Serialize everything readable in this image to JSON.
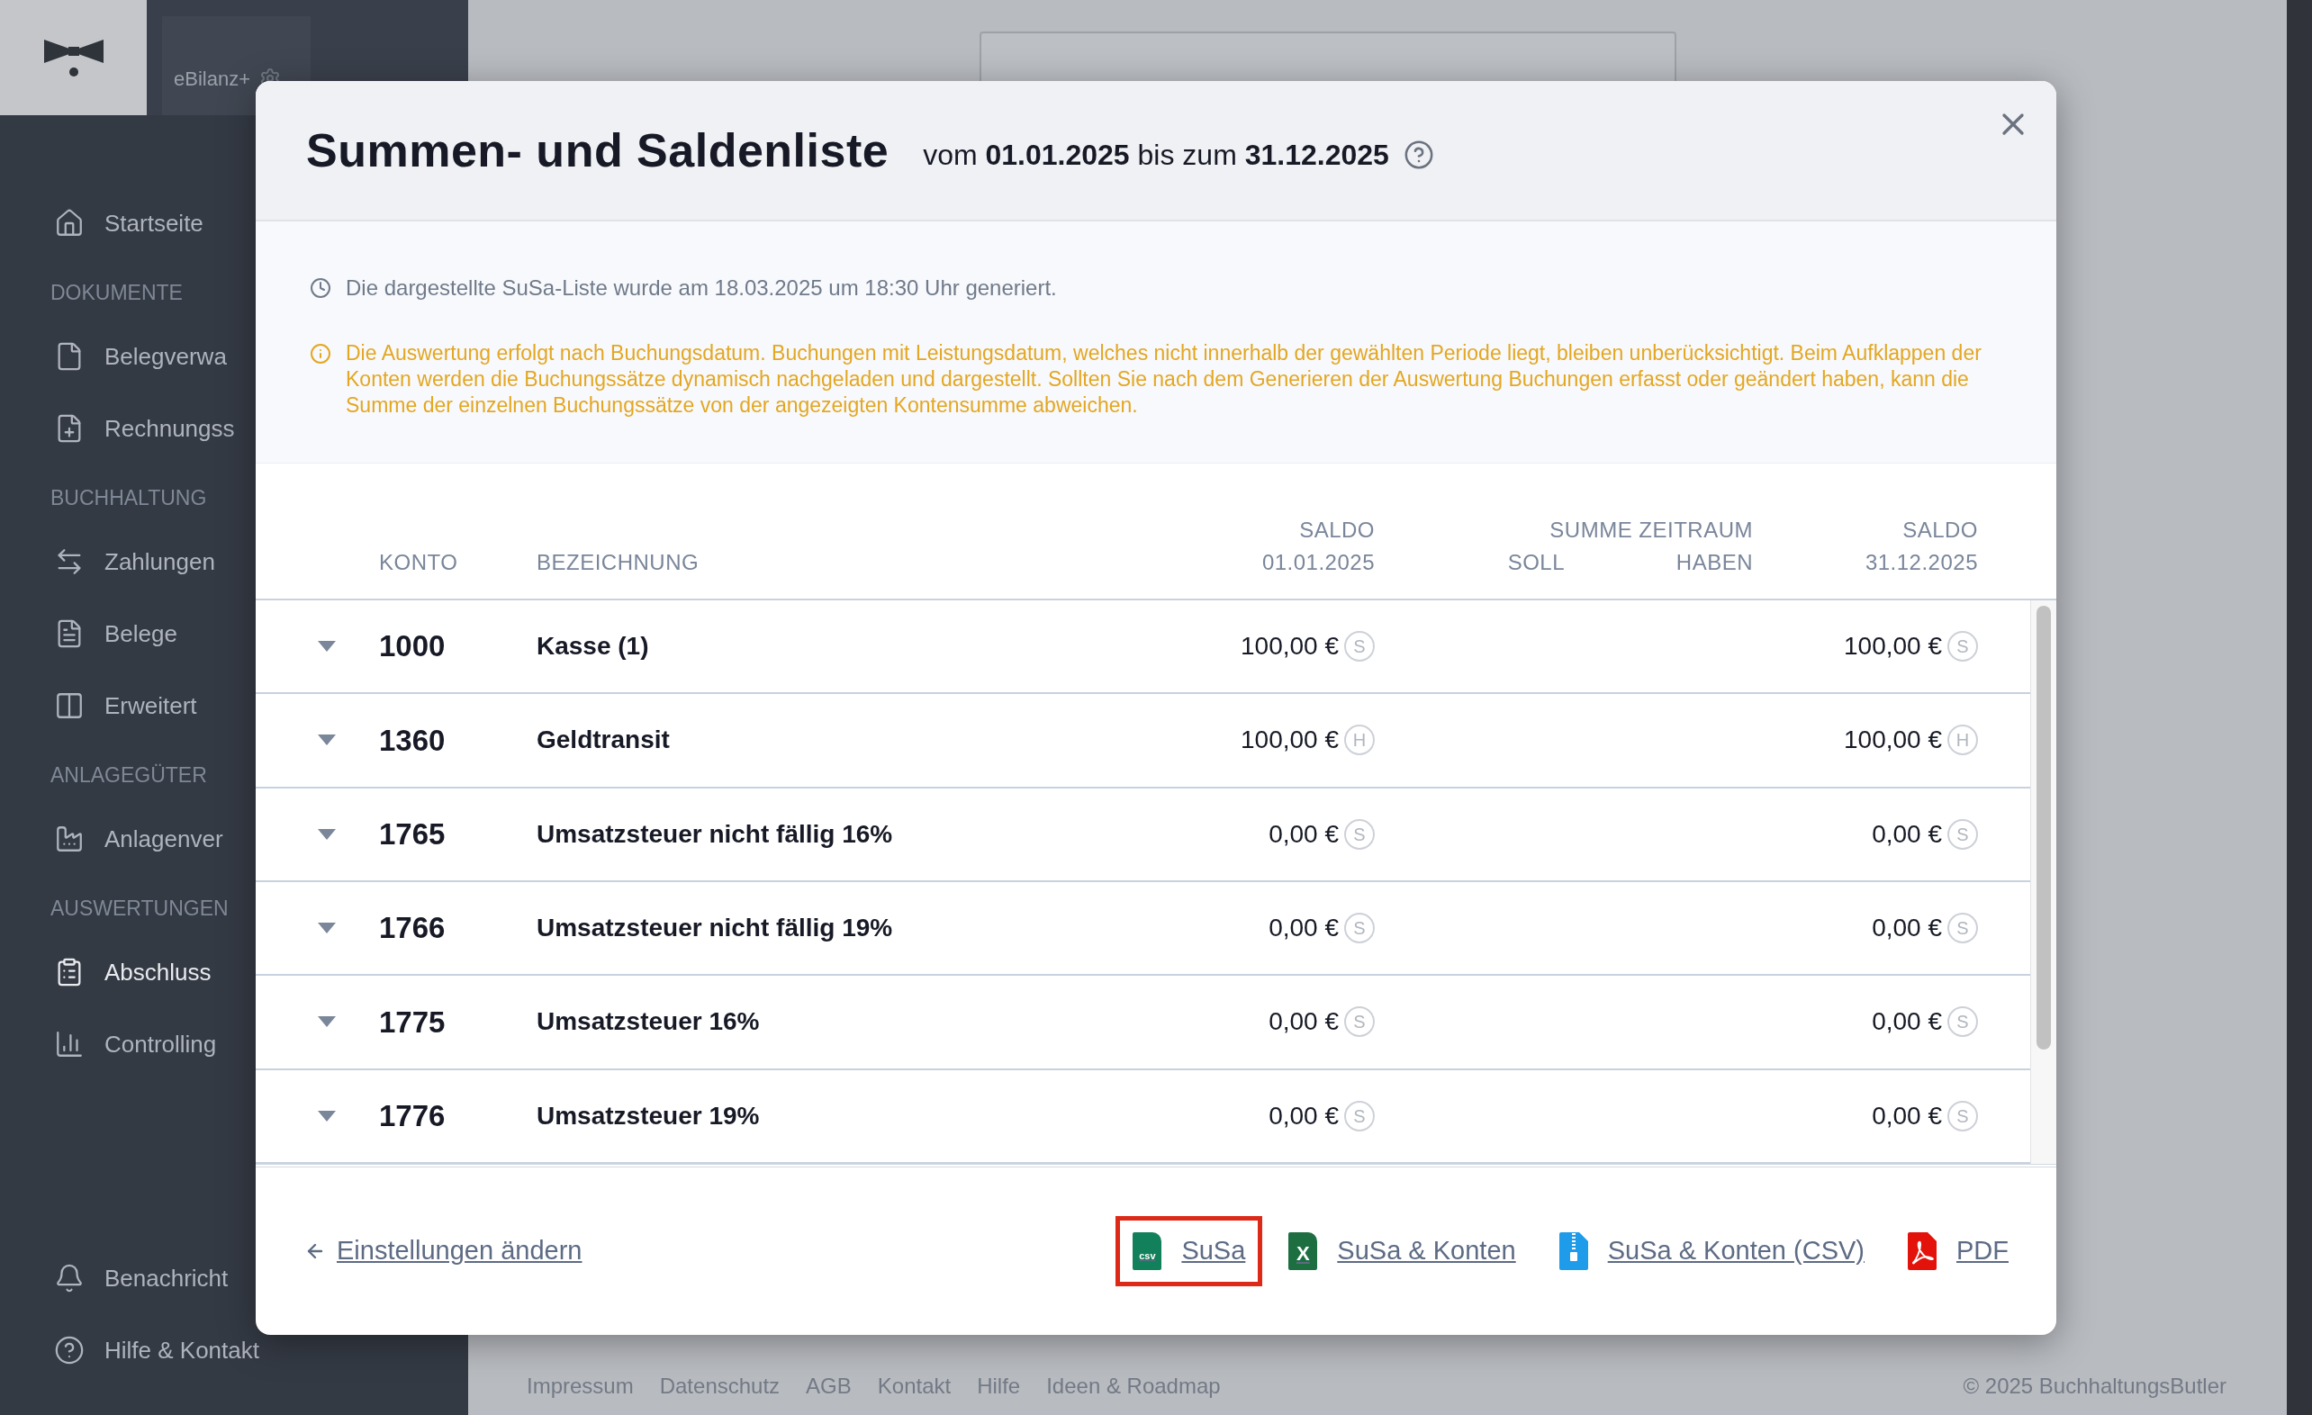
{
  "sidebar": {
    "brand": "eBilanz+",
    "sections": [
      {
        "items": [
          {
            "label": "Startseite",
            "selected": false
          }
        ]
      },
      {
        "title": "DOKUMENTE",
        "items": [
          {
            "label": "Belegverwa",
            "selected": false
          },
          {
            "label": "Rechnungss",
            "selected": false
          }
        ]
      },
      {
        "title": "BUCHHALTUNG",
        "items": [
          {
            "label": "Zahlungen",
            "selected": false
          },
          {
            "label": "Belege",
            "selected": false
          },
          {
            "label": "Erweitert",
            "selected": false
          }
        ]
      },
      {
        "title": "ANLAGEGÜTER",
        "items": [
          {
            "label": "Anlagenver",
            "selected": false
          }
        ]
      },
      {
        "title": "AUSWERTUNGEN",
        "items": [
          {
            "label": "Abschluss",
            "selected": true
          },
          {
            "label": "Controlling",
            "selected": false
          }
        ]
      }
    ],
    "bottom_items": [
      {
        "label": "Benachricht",
        "selected": false
      },
      {
        "label": "Hilfe & Kontakt",
        "selected": false
      }
    ]
  },
  "modal": {
    "title": "Summen- und Saldenliste",
    "period": "vom **01.01.2025** bis zum **31.12.2025**",
    "info": "Die dargestellte SuSa-Liste wurde am 18.03.2025 um 18:30 Uhr generiert.",
    "warning": "Die Auswertung erfolgt nach Buchungsdatum. Buchungen mit Leistungsdatum, welches nicht innerhalb der gewählten Periode liegt, bleiben unberücksichtigt. Beim Aufklappen der Konten werden die Buchungssätze dynamisch nachgeladen und dargestellt. Sollten Sie nach dem Generieren der Auswertung Buchungen erfasst oder geändert haben, kann die Summe der einzelnen Buchungssätze von der angezeigten Kontensumme abweichen.",
    "table": {
      "columns": {
        "konto": "KONTO",
        "bezeichnung": "BEZEICHNUNG",
        "saldo_start": [
          "SALDO",
          "01.01.2025"
        ],
        "summe_zeitraum": "SUMME ZEITRAUM",
        "soll": "SOLL",
        "haben": "HABEN",
        "saldo_end": [
          "SALDO",
          "31.12.2025"
        ]
      },
      "rows": [
        {
          "konto": "1000",
          "name": "Kasse (1)",
          "saldo_start": "100,00 €",
          "saldo_start_side": "S",
          "saldo_end": "100,00 €",
          "saldo_end_side": "S"
        },
        {
          "konto": "1360",
          "name": "Geldtransit",
          "saldo_start": "100,00 €",
          "saldo_start_side": "H",
          "saldo_end": "100,00 €",
          "saldo_end_side": "H"
        },
        {
          "konto": "1765",
          "name": "Umsatzsteuer nicht fällig 16%",
          "saldo_start": "0,00 €",
          "saldo_start_side": "S",
          "saldo_end": "0,00 €",
          "saldo_end_side": "S"
        },
        {
          "konto": "1766",
          "name": "Umsatzsteuer nicht fällig 19%",
          "saldo_start": "0,00 €",
          "saldo_start_side": "S",
          "saldo_end": "0,00 €",
          "saldo_end_side": "S"
        },
        {
          "konto": "1775",
          "name": "Umsatzsteuer 16%",
          "saldo_start": "0,00 €",
          "saldo_start_side": "S",
          "saldo_end": "0,00 €",
          "saldo_end_side": "S"
        },
        {
          "konto": "1776",
          "name": "Umsatzsteuer 19%",
          "saldo_start": "0,00 €",
          "saldo_start_side": "S",
          "saldo_end": "0,00 €",
          "saldo_end_side": "S"
        }
      ]
    },
    "back_link": "Einstellungen ändern",
    "downloads": [
      {
        "label": "SuSa",
        "kind": "csv",
        "icon_text": "csv",
        "highlighted": true
      },
      {
        "label": "SuSa & Konten",
        "kind": "excel",
        "icon_text": "X",
        "highlighted": false
      },
      {
        "label": "SuSa & Konten (CSV)",
        "kind": "zip",
        "highlighted": false
      },
      {
        "label": "PDF",
        "kind": "pdf",
        "highlighted": false
      }
    ]
  },
  "page_footer": {
    "links": [
      "Impressum",
      "Datenschutz",
      "AGB",
      "Kontakt",
      "Hilfe",
      "Ideen & Roadmap"
    ],
    "copyright": "© 2025 BuchhaltungsButler"
  }
}
